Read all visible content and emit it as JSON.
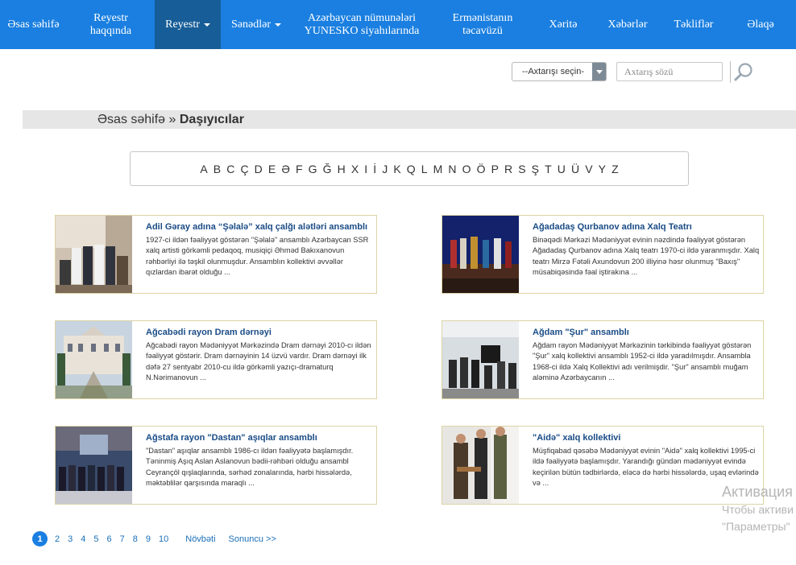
{
  "nav": {
    "items": [
      {
        "label": "Əsas səhifə"
      },
      {
        "label": "Reyestr haqqında"
      },
      {
        "label": "Reyestr"
      },
      {
        "label": "Sənədlər"
      },
      {
        "label": "Azərbaycan nümunələri YUNESKO siyahılarında"
      },
      {
        "label": "Ermənistanın təcavüzü"
      },
      {
        "label": "Xəritə"
      },
      {
        "label": "Xəbərlər"
      },
      {
        "label": "Təkliflər"
      },
      {
        "label": "Əlaqə"
      }
    ]
  },
  "search": {
    "select_value": "--Axtarışı seçin-",
    "placeholder": "Axtarış sözü"
  },
  "breadcrumb": {
    "home": "Əsas səhifə",
    "separator": " » ",
    "current": "Daşıyıcılar"
  },
  "alphabet": [
    "A",
    "B",
    "C",
    "Ç",
    "D",
    "E",
    "Ə",
    "F",
    "G",
    "Ğ",
    "H",
    "X",
    "I",
    "İ",
    "J",
    "K",
    "Q",
    "L",
    "M",
    "N",
    "O",
    "Ö",
    "P",
    "R",
    "S",
    "Ş",
    "T",
    "U",
    "Ü",
    "V",
    "Y",
    "Z"
  ],
  "cards": [
    {
      "title": "Adil Gəray adına “Şəlalə” xalq çalğı alətləri ansamblı",
      "text": "1927-ci ildən fəaliyyət göstərən \"Şəlalə\" ansamblı Azərbaycan SSR xalq artisti görkəmli pedaqoq, musiqiçi Əhməd Bakıxanovun rəhbərliyi ilə təşkil olunmuşdur. Ansamblın kollektivi əvvəllər qızlardan ibarət olduğu ..."
    },
    {
      "title": "Ağadadaş Qurbanov adına Xalq Teatrı",
      "text": "Binəqədi Mərkəzi Mədəniyyət evinin nəzdində fəaliyyət göstərən Ağadadaş Qurbanov adına Xalq teatrı 1970-ci ildə yaranmışdır. Xalq teatrı Mirzə Fətəli Axundovun 200 illiyinə həsr olunmuş \"Baxış\" müsabiqəsində fəal iştirakına ..."
    },
    {
      "title": "Ağcabədi rayon Dram dərnəyi",
      "text": "Ağcabədi rayon Mədəniyyət Mərkəzində Dram dərnəyi 2010-cı ildən fəaliyyət göstərir. Dram dərnəyinin 14 üzvü vardır. Dram dərnəyi ilk dəfə 27 sentyabr 2010-cu ildə görkəmli yazıçı-dramaturq N.Nərimanovun ..."
    },
    {
      "title": "Ağdam \"Şur\" ansamblı",
      "text": "Ağdam rayon Mədəniyyət Mərkəzinin tərkibində fəaliyyət göstərən \"Şur\" xalq kollektivi ansamblı 1952-ci ildə yaradılmışdır. Ansambla 1968-ci ildə Xalq Kollektivi adı verilmişdir. \"Şur\" ansamblı muğam aləminə Azərbaycanın ..."
    },
    {
      "title": "Ağstafa rayon \"Dastan\" aşıqlar ansamblı",
      "text": "\"Dastan\" aşıqlar ansamblı 1986-cı ildən fəaliyyətə başlamışdır. Təninmiş Aşıq Aslan Aslanovun bədii-rəhbəri olduğu ansambl Ceyrançöl qışlaqlarında, sərhəd zonalarında, hərbi hissələrdə, məktəblilər qarşısında maraqlı ..."
    },
    {
      "title": "\"Aidə\" xalq kollektivi",
      "text": "Müşfiqabad qəsəbə Mədəniyyət evinin \"Aidə\" xalq kollektivi 1995-ci ildə fəaliyyətə başlamışdır. Yarandığı gündən mədəniyyət evində keçirilən bütün tədbirlərdə, eləcə də hərbi hissələrdə, uşaq evlərində və ..."
    }
  ],
  "pagination": {
    "pages": [
      "1",
      "2",
      "3",
      "4",
      "5",
      "6",
      "7",
      "8",
      "9",
      "10"
    ],
    "current": "1",
    "next": "Növbəti",
    "last": "Sonuncu >>"
  },
  "watermark": {
    "line1": "Активация",
    "line2": "Чтобы активи",
    "line3": "\"Параметры\""
  },
  "colors": {
    "nav_bg": "#1a7fe0",
    "nav_active": "#175d97",
    "card_border": "#ddd3a6",
    "title_link": "#1a4c86"
  }
}
